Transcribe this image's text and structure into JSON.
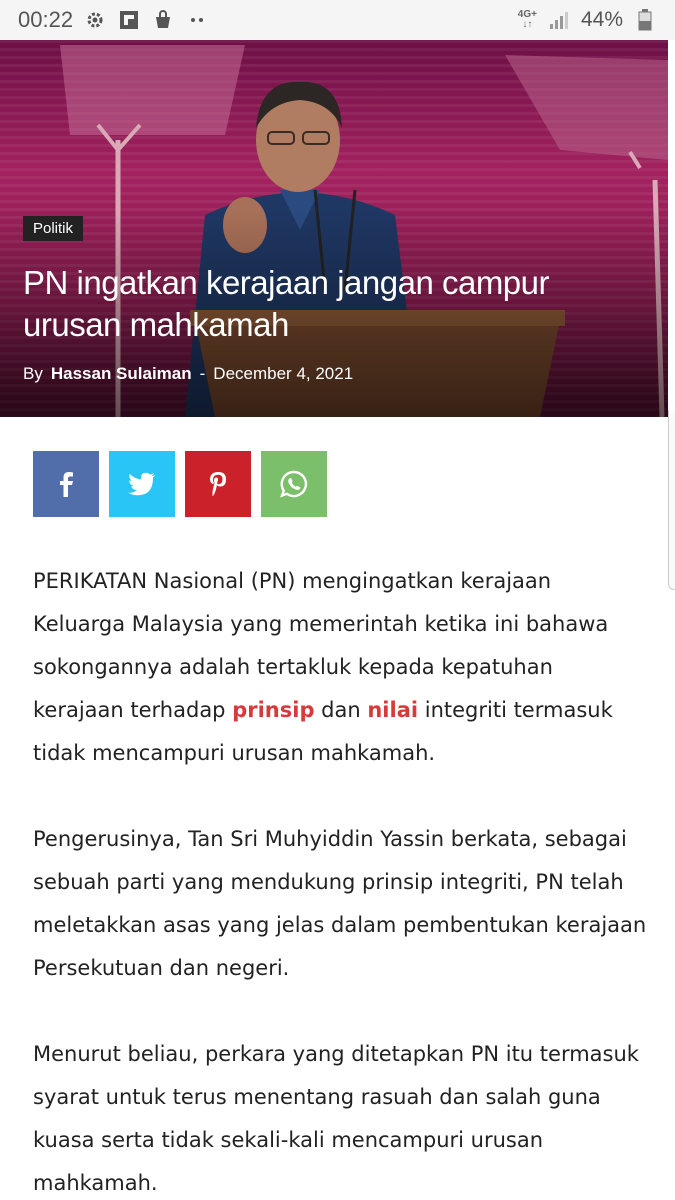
{
  "status_bar": {
    "time": "00:22",
    "network": "4G+",
    "battery_percent": "44%",
    "icons": [
      "settings-icon",
      "flipboard-icon",
      "shopping-bag-icon",
      "more-dots-icon",
      "network-icon",
      "signal-icon",
      "battery-icon"
    ]
  },
  "article": {
    "category": "Politik",
    "title": "PN ingatkan kerajaan jangan campur urusan mahkamah",
    "byline_prefix": "By",
    "author": "Hassan Sulaiman",
    "separator": "-",
    "date": "December 4, 2021",
    "share": {
      "icons": [
        "facebook-icon",
        "twitter-icon",
        "pinterest-icon",
        "whatsapp-icon"
      ],
      "colors": {
        "facebook": "#516eab",
        "twitter": "#29c5f6",
        "pinterest": "#ca212a",
        "whatsapp": "#7bbf6a"
      }
    },
    "p1_part1": "PERIKATAN Nasional (PN) mengingatkan kerajaan Keluarga Malaysia yang memerintah ketika ini bahawa sokongannya adalah tertakluk kepada kepatuhan kerajaan terhadap ",
    "p1_link1": "prinsip",
    "p1_part2": " dan ",
    "p1_link2": "nilai",
    "p1_part3": " integriti termasuk tidak mencampuri urusan mahkamah.",
    "p2": "Pengerusinya, Tan Sri Muhyiddin Yassin berkata, sebagai sebuah parti yang mendukung prinsip integriti, PN telah meletakkan asas yang jelas dalam pembentukan kerajaan Persekutuan dan negeri.",
    "p3": "Menurut beliau, perkara yang ditetapkan PN itu termasuk syarat untuk terus menentang rasuah dan salah guna kuasa serta tidak sekali-kali mencampuri urusan mahkamah."
  },
  "colors": {
    "accent_link": "#d63a3a",
    "hero_magenta": "#a3225f"
  }
}
